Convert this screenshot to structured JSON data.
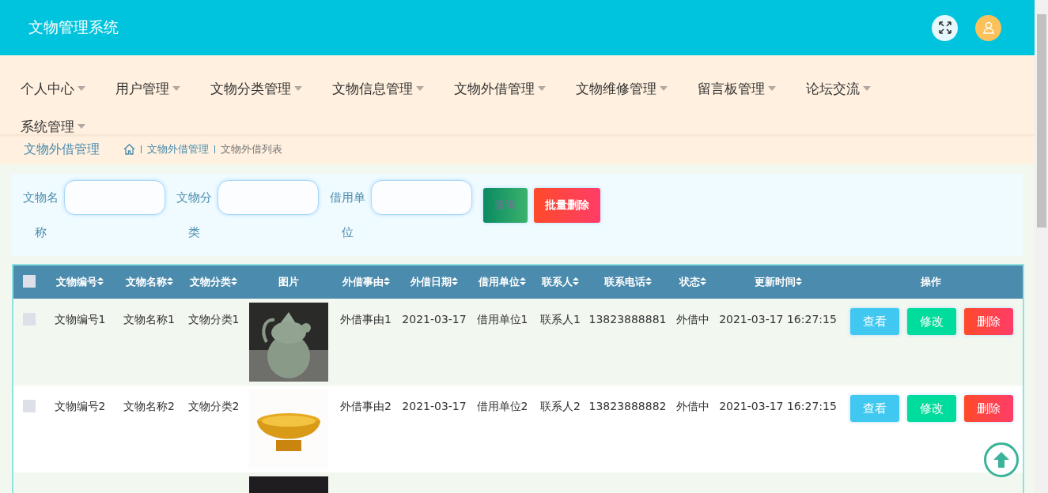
{
  "header": {
    "title": "文物管理系统"
  },
  "nav": [
    {
      "label": "个人中心"
    },
    {
      "label": "用户管理"
    },
    {
      "label": "文物分类管理"
    },
    {
      "label": "文物信息管理"
    },
    {
      "label": "文物外借管理"
    },
    {
      "label": "文物维修管理"
    },
    {
      "label": "留言板管理"
    },
    {
      "label": "论坛交流"
    },
    {
      "label": "系统管理"
    }
  ],
  "page_title": "文物外借管理",
  "breadcrumb": [
    "文物外借管理",
    "文物外借列表"
  ],
  "filters": [
    {
      "label": "文物名称"
    },
    {
      "label": "文物分类"
    },
    {
      "label": "借用单位"
    }
  ],
  "filter_buttons": [
    {
      "label": "查询",
      "kind": "search"
    },
    {
      "label": "批量删除",
      "kind": "delete"
    }
  ],
  "table": {
    "header_checked": false,
    "columns": [
      {
        "label": "文物编号",
        "sortable": true
      },
      {
        "label": "文物名称",
        "sortable": true
      },
      {
        "label": "文物分类",
        "sortable": true
      },
      {
        "label": "图片",
        "sortable": false
      },
      {
        "label": "外借事由",
        "sortable": true
      },
      {
        "label": "外借日期",
        "sortable": true
      },
      {
        "label": "借用单位",
        "sortable": true
      },
      {
        "label": "联系人",
        "sortable": true
      },
      {
        "label": "联系电话",
        "sortable": true
      },
      {
        "label": "状态",
        "sortable": true
      },
      {
        "label": "更新时间",
        "sortable": true
      },
      {
        "label": "操作",
        "sortable": false
      }
    ],
    "rows": [
      {
        "checked": false,
        "cells": [
          "文物编号1",
          "文物名称1",
          "文物分类1"
        ],
        "rest": [
          "外借事由1",
          "2021-03-17",
          "借用单位1",
          "联系人1",
          "13823888881",
          "外借中",
          "2021-03-17 16:27:15"
        ],
        "actions": [
          "查看",
          "修改",
          "删除"
        ]
      },
      {
        "checked": false,
        "cells": [
          "文物编号2",
          "文物名称2",
          "文物分类2"
        ],
        "rest": [
          "外借事由2",
          "2021-03-17",
          "借用单位2",
          "联系人2",
          "13823888882",
          "外借中",
          "2021-03-17 16:27:15"
        ],
        "actions": [
          "查看",
          "修改",
          "删除"
        ]
      }
    ]
  }
}
